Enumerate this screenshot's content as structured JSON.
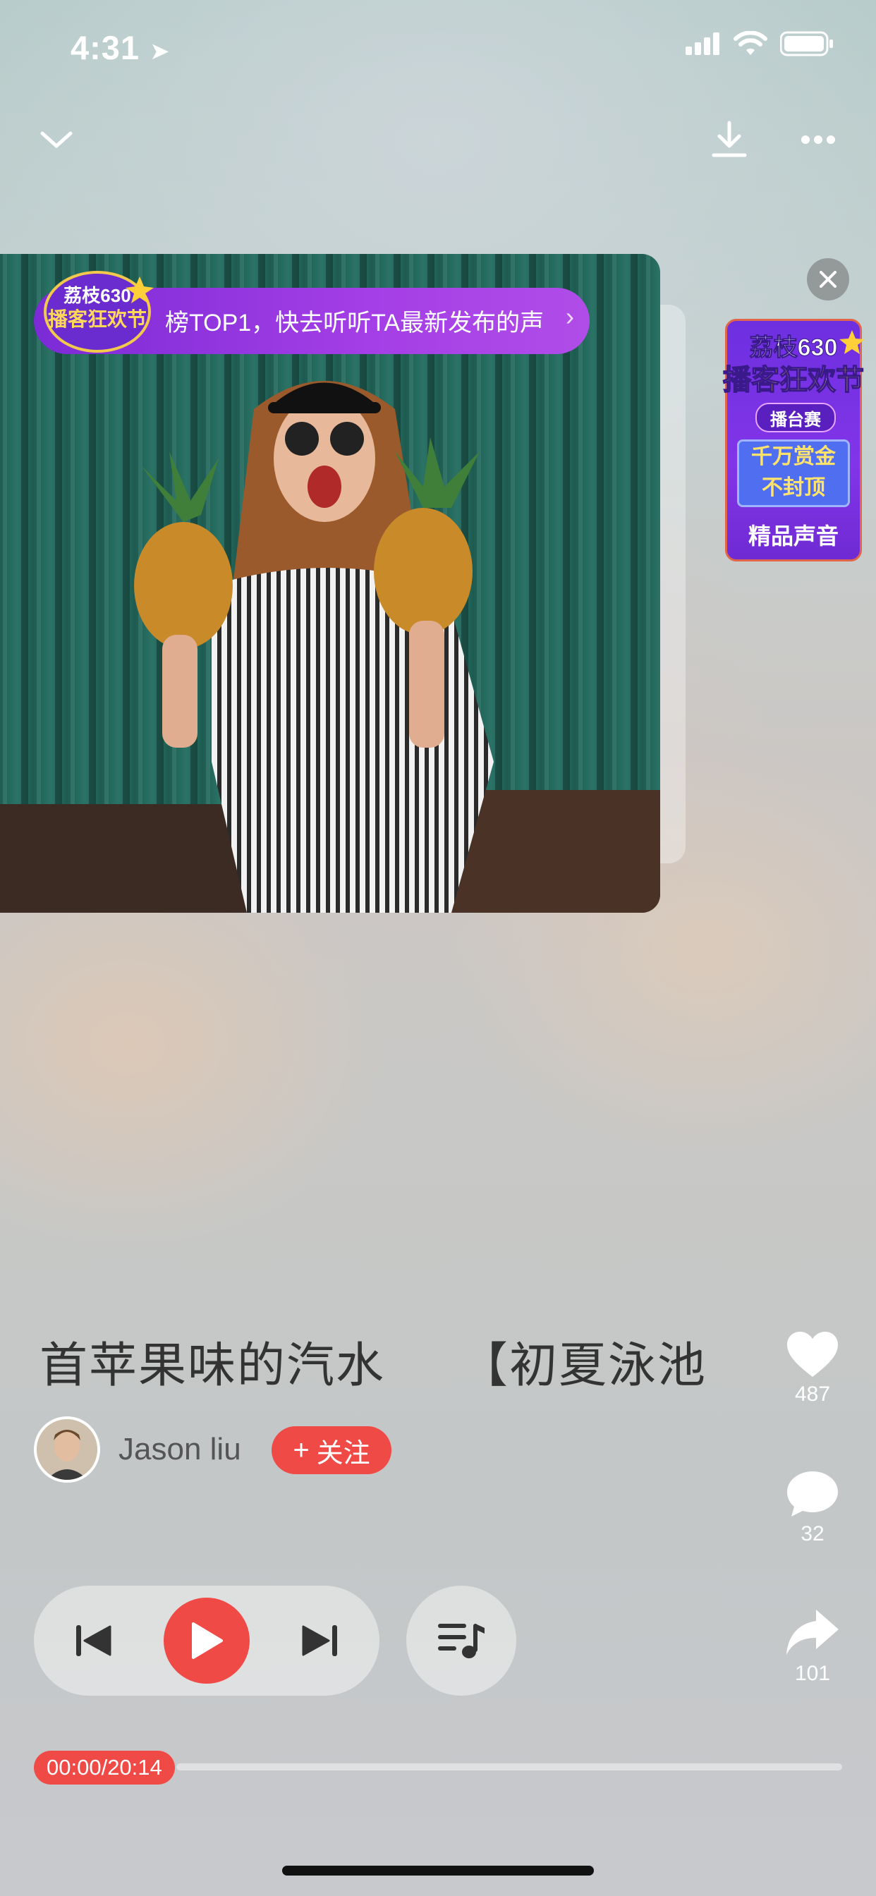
{
  "status_bar": {
    "time": "4:31"
  },
  "promo": {
    "logo_line1": "荔枝630",
    "logo_line2": "播客狂欢节",
    "banner_text": "榜TOP1，快去听听TA最新发布的声"
  },
  "ad": {
    "line1": "荔枝630",
    "line2": "播客狂欢节",
    "tag": "播台赛",
    "prize": "千万赏金",
    "prize2": "不封顶",
    "footer": "精品声音"
  },
  "track": {
    "title": "首苹果味的汽水　　【初夏泳池",
    "author": "Jason  liu",
    "follow_label": "关注"
  },
  "side": {
    "likes": "487",
    "comments": "32",
    "shares": "101"
  },
  "progress": {
    "time": "00:00/20:14",
    "fraction": 0
  },
  "colors": {
    "accent": "#f04a47",
    "promo": "#9b3be3"
  }
}
